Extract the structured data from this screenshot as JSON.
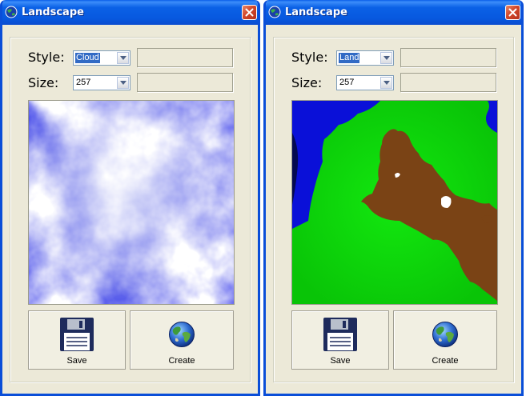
{
  "colors": {
    "titlebar": "#0A5FE9",
    "frame": "#0A4ED8",
    "dialog_bg": "#ECE9D8",
    "selection": "#316AC5"
  },
  "windows": [
    {
      "title": "Landscape",
      "style_label": "Style:",
      "style_value": "Cloud",
      "size_label": "Size:",
      "size_value": "257",
      "preview": "cloud-texture",
      "save_label": "Save",
      "create_label": "Create"
    },
    {
      "title": "Landscape",
      "style_label": "Style:",
      "style_value": "Land",
      "size_label": "Size:",
      "size_value": "257",
      "preview": "land-terrain-map",
      "save_label": "Save",
      "create_label": "Create"
    }
  ]
}
